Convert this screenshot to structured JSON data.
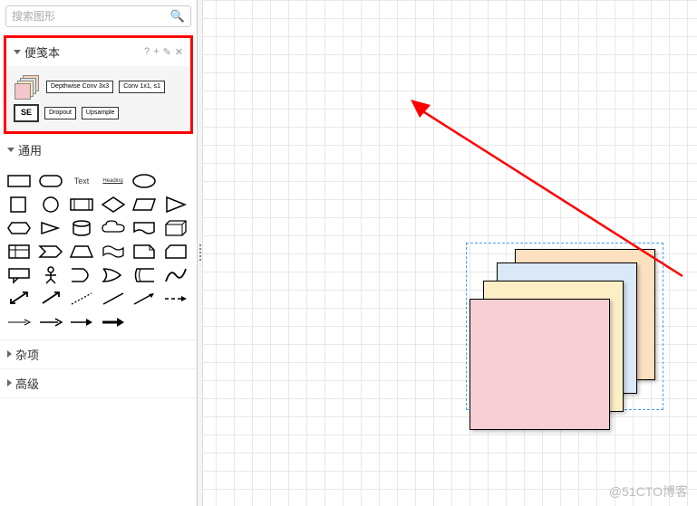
{
  "search": {
    "placeholder": "搜索图形"
  },
  "panels": {
    "scratchpad": {
      "title": "便笺本",
      "items": [
        "",
        "Depthwise Conv 3x3",
        "Conv 1x1, s1",
        "SE",
        "Dropout",
        "Upsample"
      ],
      "actions": [
        "?",
        "+",
        "✎",
        "✕"
      ]
    },
    "general": {
      "title": "通用",
      "text_shape": "Text",
      "heading_shape": "Heading"
    },
    "misc": {
      "title": "杂项"
    },
    "advanced": {
      "title": "高级"
    }
  },
  "watermark": "@51CTO博客"
}
